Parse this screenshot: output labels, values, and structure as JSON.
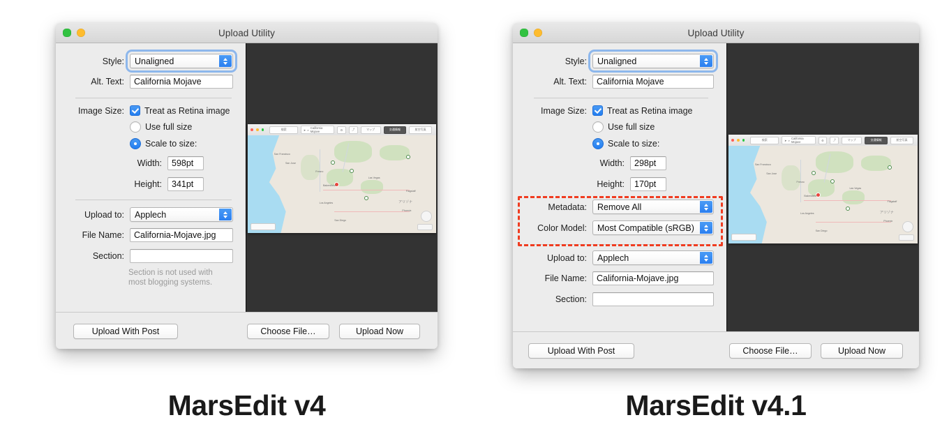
{
  "colors": {
    "accent_blue": "#2b7ff0",
    "highlight_red": "#f03c20",
    "window_bg": "#ececec",
    "preview_bg": "#333333",
    "page_bg": "#ffffff"
  },
  "windows": [
    {
      "id": "left",
      "title": "Upload Utility",
      "caption": "MarsEdit v4",
      "traffic_lights": [
        "close",
        "minimize",
        "zoom"
      ],
      "fields": {
        "style_label": "Style:",
        "style_value": "Unaligned",
        "alt_text_label": "Alt. Text:",
        "alt_text_value": "California Mojave",
        "image_size_label": "Image Size:",
        "retina_label": "Treat as Retina image",
        "retina_checked": true,
        "use_full_size_label": "Use full size",
        "use_full_size_selected": false,
        "scale_to_size_label": "Scale to size:",
        "scale_to_size_selected": true,
        "width_label": "Width:",
        "width_value": "598pt",
        "height_label": "Height:",
        "height_value": "341pt",
        "upload_to_label": "Upload to:",
        "upload_to_value": "Applech",
        "file_name_label": "File Name:",
        "file_name_value": "California-Mojave.jpg",
        "section_label": "Section:",
        "section_value": "",
        "section_hint_line1": "Section is not used with",
        "section_hint_line2": "most blogging systems."
      },
      "buttons": {
        "upload_with_post": "Upload With Post",
        "choose_file": "Choose File…",
        "upload_now": "Upload Now"
      },
      "has_metadata_section": false,
      "has_section_hint": true
    },
    {
      "id": "right",
      "title": "Upload Utility",
      "caption": "MarsEdit v4.1",
      "traffic_lights": [
        "close",
        "minimize",
        "zoom"
      ],
      "fields": {
        "style_label": "Style:",
        "style_value": "Unaligned",
        "alt_text_label": "Alt. Text:",
        "alt_text_value": "California Mojave",
        "image_size_label": "Image Size:",
        "retina_label": "Treat as Retina image",
        "retina_checked": true,
        "use_full_size_label": "Use full size",
        "use_full_size_selected": false,
        "scale_to_size_label": "Scale to size:",
        "scale_to_size_selected": true,
        "width_label": "Width:",
        "width_value": "298pt",
        "height_label": "Height:",
        "height_value": "170pt",
        "metadata_label": "Metadata:",
        "metadata_value": "Remove All",
        "color_model_label": "Color Model:",
        "color_model_value": "Most Compatible (sRGB)",
        "upload_to_label": "Upload to:",
        "upload_to_value": "Applech",
        "file_name_label": "File Name:",
        "file_name_value": "California-Mojave.jpg",
        "section_label": "Section:",
        "section_value": ""
      },
      "buttons": {
        "upload_with_post": "Upload With Post",
        "choose_file": "Choose File…",
        "upload_now": "Upload Now"
      },
      "has_metadata_section": true,
      "has_section_hint": false
    }
  ],
  "map_preview": {
    "search_value": "California Mojave",
    "toolbar_buttons": [
      "検索",
      "マップ",
      "交通情報",
      "航空写真"
    ],
    "selected_toolbar_button": "交通情報",
    "bottom_selector": "画質",
    "city_labels": [
      "San Francisco",
      "San Jose",
      "Fresno",
      "Bakersfield",
      "Los Angeles",
      "San Diego",
      "Las Vegas",
      "Flagstaff",
      "Phoenix"
    ],
    "region_label": "アリゾナ"
  }
}
